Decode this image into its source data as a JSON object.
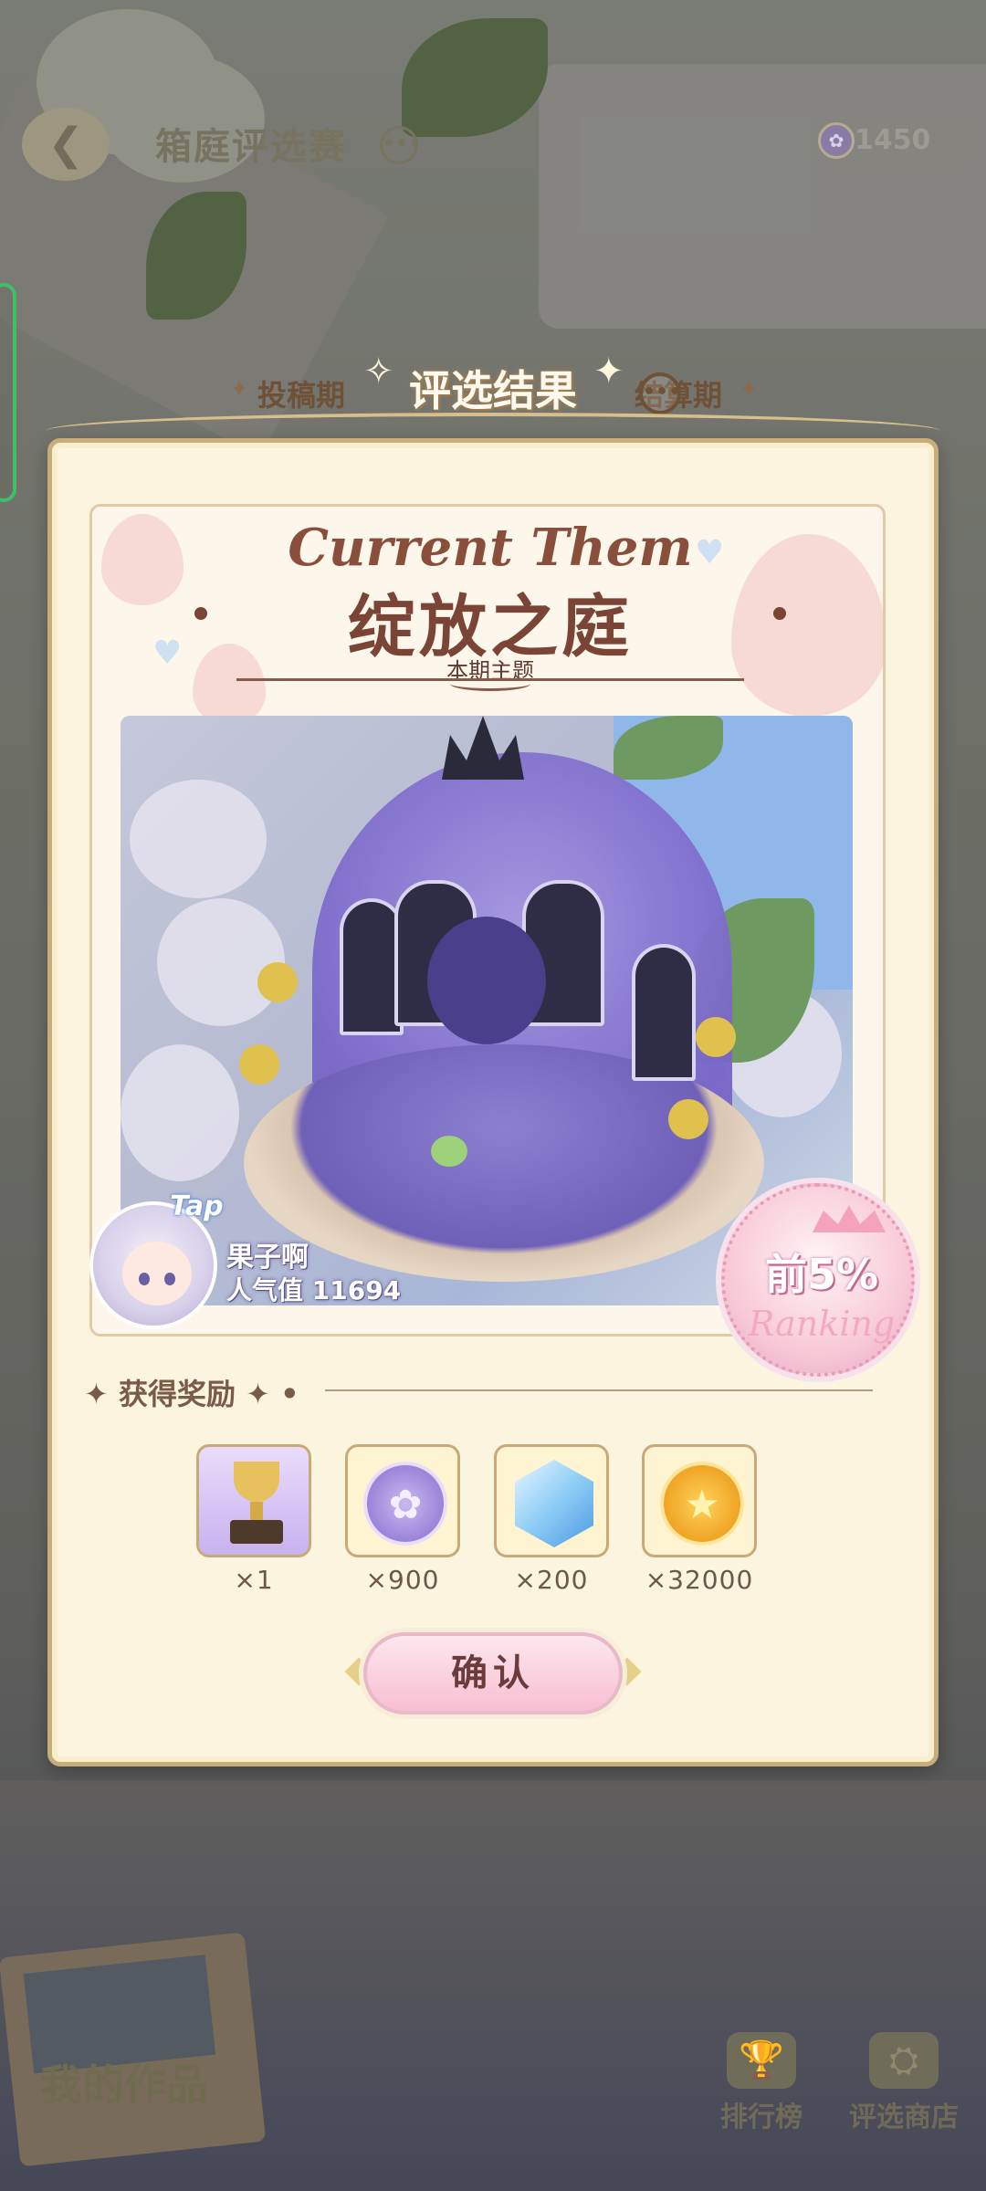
{
  "header": {
    "back_icon": "back-arrow-icon",
    "title": "箱庭评选赛",
    "more_icon": "ellipsis-icon",
    "currency": {
      "icon": "flower-coin-icon",
      "value": "1450"
    }
  },
  "phases": {
    "left": "投稿期",
    "current": "评选结果",
    "right": "结算期"
  },
  "theme": {
    "english": "Current Them",
    "title": "绽放之庭",
    "subtitle": "本期主题"
  },
  "entry": {
    "tap_label": "Tap",
    "creator_name": "果子啊",
    "popularity": "人气值 11694",
    "rank": "前5%",
    "rank_script": "Ranking"
  },
  "rewards": {
    "header": "获得奖励",
    "items": [
      {
        "icon": "trophy-icon",
        "count": "×1"
      },
      {
        "icon": "flower-coin-icon",
        "count": "×900"
      },
      {
        "icon": "crystal-gem-icon",
        "count": "×200"
      },
      {
        "icon": "star-coin-icon",
        "count": "×32000"
      }
    ]
  },
  "confirm_label": "确认",
  "bottom": {
    "my_works": "我的作品",
    "leaderboard": "排行榜",
    "shop": "评选商店"
  },
  "colors": {
    "dialog_bg": "#fbf5e0",
    "title_brown": "#7a4536",
    "accent_pink": "#f7bfd2"
  }
}
